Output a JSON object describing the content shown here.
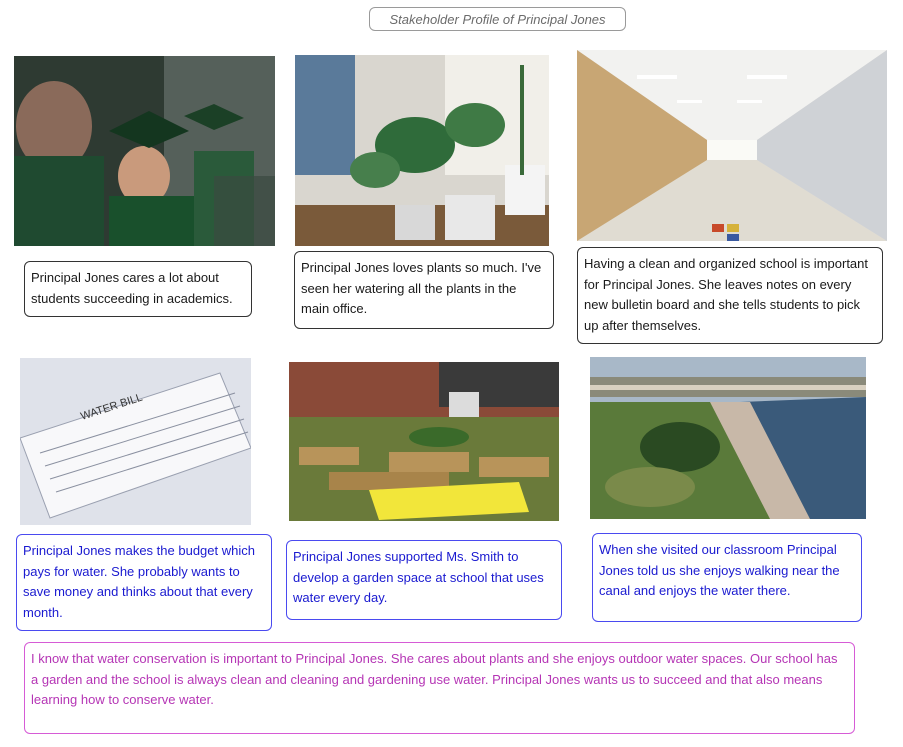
{
  "title": "Stakeholder Profile of Principal Jones",
  "photos": [
    {
      "name": "graduation-photo"
    },
    {
      "name": "watering-plants-photo"
    },
    {
      "name": "school-hallway-photo"
    },
    {
      "name": "water-bill-photo",
      "label": "WATER BILL"
    },
    {
      "name": "school-garden-photo"
    },
    {
      "name": "canal-waterfront-photo"
    }
  ],
  "cards": {
    "academics": "Principal Jones cares a lot about students succeeding in academics.",
    "plants": "Principal Jones loves plants so much. I've seen her watering all the plants in the main office.",
    "clean": "Having a clean and organized school is important for Principal Jones. She leaves notes on every new bulletin board and she tells students to pick up after themselves.",
    "budget": "Principal Jones makes the budget which pays for water. She probably wants to save money and thinks about that every month.",
    "garden": "Principal Jones supported Ms. Smith to develop a garden space at school that uses water every day.",
    "canal": "When she visited our classroom Principal Jones told us she enjoys walking near the canal and enjoys the water there.",
    "summary": "I know that water conservation is important to Principal Jones. She cares about plants and she enjoys outdoor water spaces. Our school has a garden and the school is always clean and cleaning and gardening use water. Principal Jones wants us to succeed and that also means learning how to conserve water."
  }
}
